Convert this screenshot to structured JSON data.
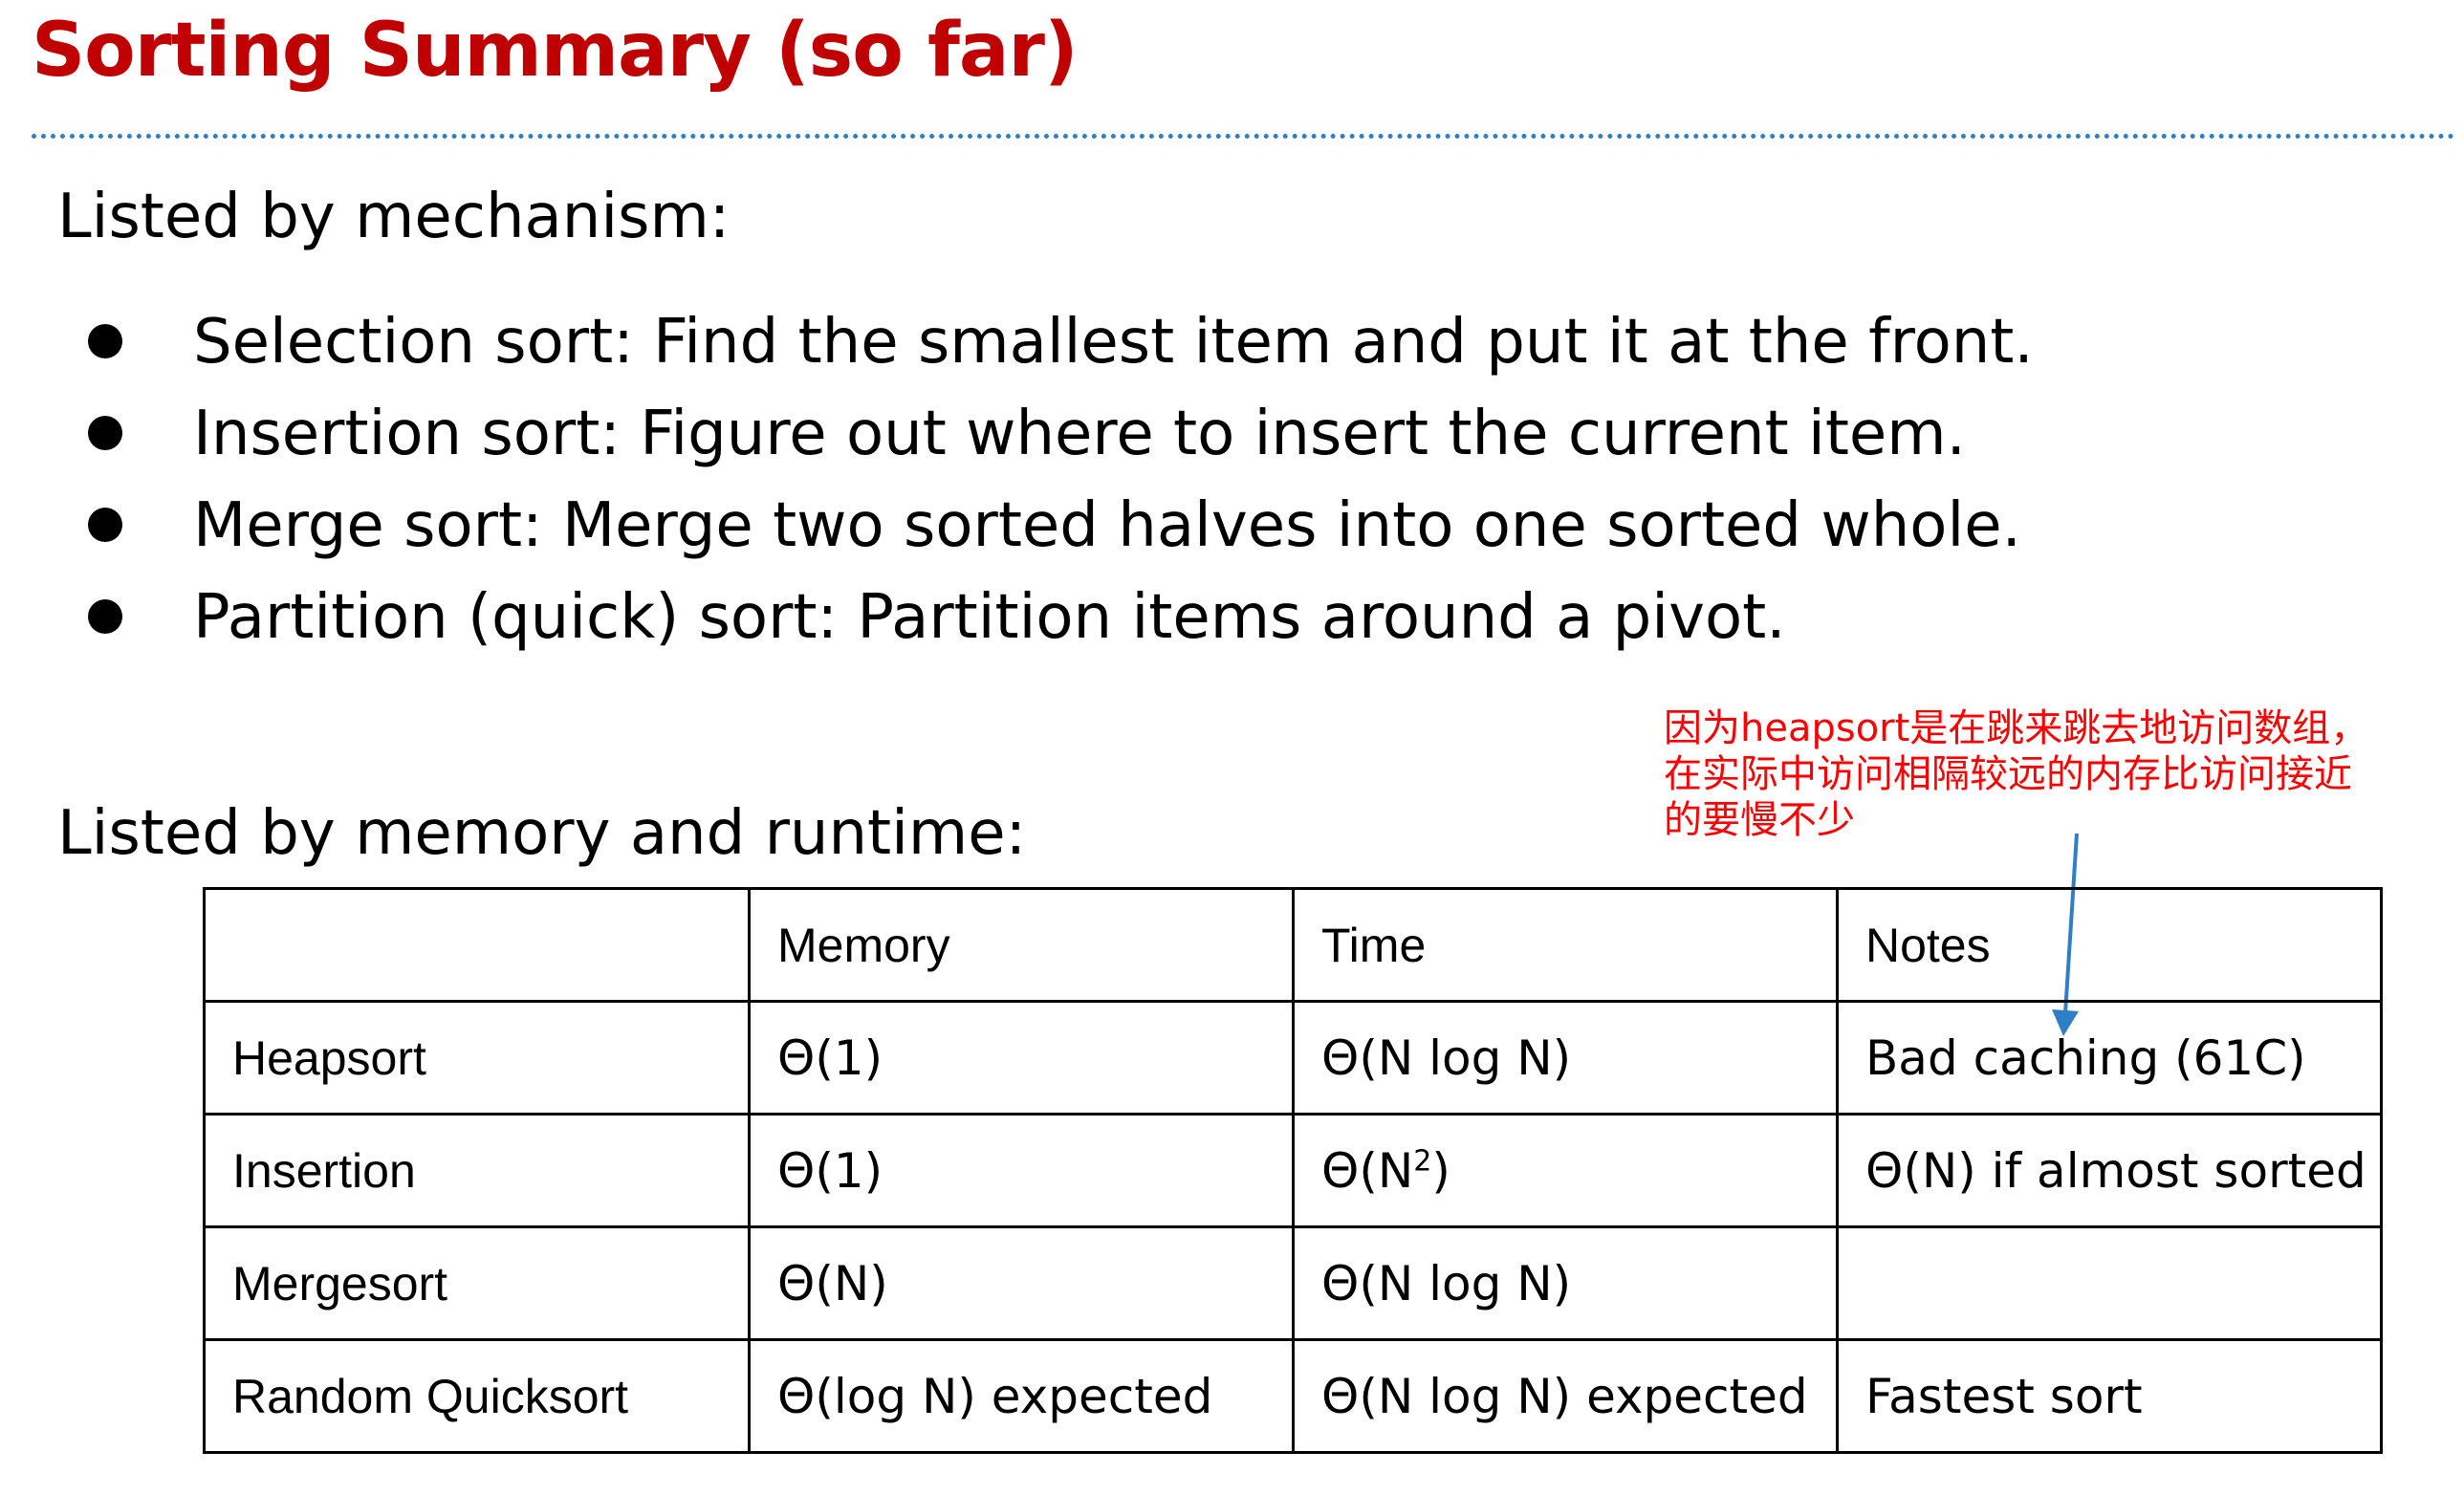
{
  "title": "Sorting Summary (so far)",
  "accent_color": "#c00000",
  "rule_color": "#2f7fc6",
  "mechanism": {
    "heading": "Listed by mechanism:",
    "items": [
      "Selection sort: Find the smallest item and put it at the front.",
      "Insertion sort: Figure out where to insert the current item.",
      "Merge sort: Merge two sorted halves into one sorted whole.",
      "Partition (quick) sort: Partition items around a pivot."
    ]
  },
  "annotation": {
    "lines": [
      "因为heapsort是在跳来跳去地访问数组，",
      "在实际中访问相隔较远的内存比访问接近",
      "的要慢不少"
    ],
    "color": "#ff0000",
    "arrow_color": "#2f7fc6"
  },
  "runtime": {
    "heading": "Listed by memory and runtime:",
    "columns": [
      "",
      "Memory",
      "Time",
      "Notes"
    ],
    "rows": [
      {
        "name": "Heapsort",
        "memory": "Θ(1)",
        "time": "Θ(N log N)",
        "time_sup": "",
        "time_after": "",
        "notes": "Bad caching (61C)"
      },
      {
        "name": "Insertion",
        "memory": "Θ(1)",
        "time": "Θ(N",
        "time_sup": "2",
        "time_after": ")",
        "notes": "Θ(N) if almost sorted"
      },
      {
        "name": "Mergesort",
        "memory": "Θ(N)",
        "time": "Θ(N log N)",
        "time_sup": "",
        "time_after": "",
        "notes": ""
      },
      {
        "name": "Random Quicksort",
        "memory": "Θ(log N) expected",
        "time": "Θ(N log N) expected",
        "time_sup": "",
        "time_after": "",
        "notes": "Fastest sort"
      }
    ]
  }
}
